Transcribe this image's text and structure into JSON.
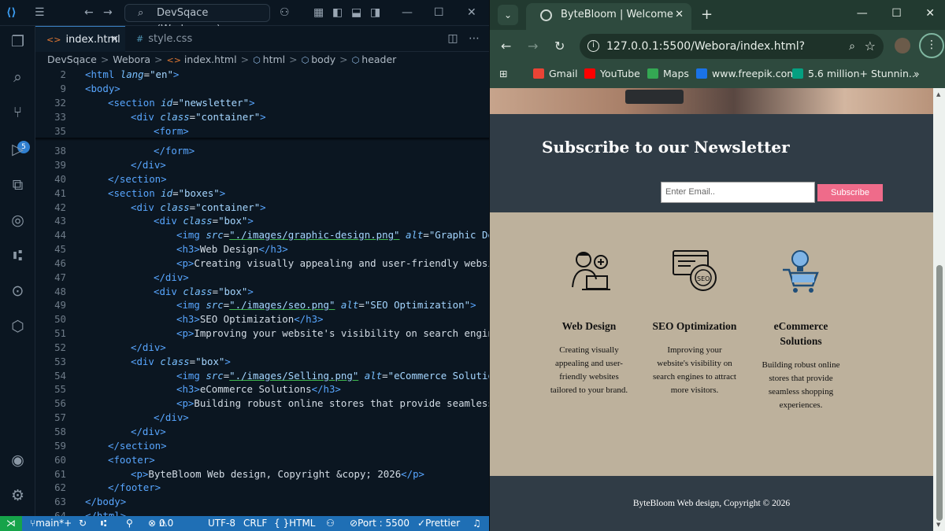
{
  "vscode": {
    "search": "DevSqace (Workspace)",
    "scm_badge": "5",
    "tabs": [
      {
        "label": "index.html"
      },
      {
        "label": "style.css"
      }
    ],
    "breadcrumb": [
      "DevSqace",
      "Webora",
      "index.html",
      "html",
      "body",
      "header"
    ],
    "lines": [
      {
        "n": "2",
        "t": [
          [
            "tg",
            "<html "
          ],
          [
            "at",
            "lang"
          ],
          [
            "tx",
            "="
          ],
          [
            "st",
            "\"en\""
          ],
          [
            "tg",
            ">"
          ]
        ],
        "ind": 0
      },
      {
        "n": "9",
        "t": [
          [
            "tg",
            "<body>"
          ]
        ],
        "ind": 0
      },
      {
        "n": "32",
        "t": [
          [
            "tg",
            "<section "
          ],
          [
            "at",
            "id"
          ],
          [
            "tx",
            "="
          ],
          [
            "st",
            "\"newsletter\""
          ],
          [
            "tg",
            ">"
          ]
        ],
        "ind": 1
      },
      {
        "n": "33",
        "t": [
          [
            "tg",
            "<div "
          ],
          [
            "at",
            "class"
          ],
          [
            "tx",
            "="
          ],
          [
            "st",
            "\"container\""
          ],
          [
            "tg",
            ">"
          ]
        ],
        "ind": 2
      },
      {
        "n": "35",
        "t": [
          [
            "tg",
            "<form>"
          ]
        ],
        "ind": 3
      },
      {
        "n": "38",
        "t": [
          [
            "tg",
            "</form>"
          ]
        ],
        "ind": 3
      },
      {
        "n": "39",
        "t": [
          [
            "tg",
            "</div>"
          ]
        ],
        "ind": 2
      },
      {
        "n": "40",
        "t": [
          [
            "tg",
            "</section>"
          ]
        ],
        "ind": 1
      },
      {
        "n": "41",
        "t": [
          [
            "tg",
            "<section "
          ],
          [
            "at",
            "id"
          ],
          [
            "tx",
            "="
          ],
          [
            "st",
            "\"boxes\""
          ],
          [
            "tg",
            ">"
          ]
        ],
        "ind": 1
      },
      {
        "n": "42",
        "t": [
          [
            "tg",
            "<div "
          ],
          [
            "at",
            "class"
          ],
          [
            "tx",
            "="
          ],
          [
            "st",
            "\"container\""
          ],
          [
            "tg",
            ">"
          ]
        ],
        "ind": 2
      },
      {
        "n": "43",
        "t": [
          [
            "tg",
            "<div "
          ],
          [
            "at",
            "class"
          ],
          [
            "tx",
            "="
          ],
          [
            "st",
            "\"box\""
          ],
          [
            "tg",
            ">"
          ]
        ],
        "ind": 3
      },
      {
        "n": "44",
        "t": [
          [
            "tg",
            "<img "
          ],
          [
            "at",
            "src"
          ],
          [
            "tx",
            "="
          ],
          [
            "st",
            "\"./images/graphic-design.png\""
          ],
          [
            "tx",
            " "
          ],
          [
            "at",
            "alt"
          ],
          [
            "tx",
            "="
          ],
          [
            "st",
            "\"Graphic Des"
          ]
        ],
        "ind": 4
      },
      {
        "n": "45",
        "t": [
          [
            "tg",
            "<h3>"
          ],
          [
            "tx",
            "Web Design"
          ],
          [
            "tg",
            "</h3>"
          ]
        ],
        "ind": 4
      },
      {
        "n": "46",
        "t": [
          [
            "tg",
            "<p>"
          ],
          [
            "tx",
            "Creating visually appealing and user-friendly websit"
          ]
        ],
        "ind": 4
      },
      {
        "n": "47",
        "t": [
          [
            "tg",
            "</div>"
          ]
        ],
        "ind": 3
      },
      {
        "n": "48",
        "t": [
          [
            "tg",
            "<div "
          ],
          [
            "at",
            "class"
          ],
          [
            "tx",
            "="
          ],
          [
            "st",
            "\"box\""
          ],
          [
            "tg",
            ">"
          ]
        ],
        "ind": 3
      },
      {
        "n": "49",
        "t": [
          [
            "tg",
            "<img "
          ],
          [
            "at",
            "src"
          ],
          [
            "tx",
            "="
          ],
          [
            "st",
            "\"./images/seo.png\""
          ],
          [
            "tx",
            " "
          ],
          [
            "at",
            "alt"
          ],
          [
            "tx",
            "="
          ],
          [
            "st",
            "\"SEO Optimization\""
          ],
          [
            "tg",
            ">"
          ]
        ],
        "ind": 4
      },
      {
        "n": "50",
        "t": [
          [
            "tg",
            "<h3>"
          ],
          [
            "tx",
            "SEO Optimization"
          ],
          [
            "tg",
            "</h3>"
          ]
        ],
        "ind": 4
      },
      {
        "n": "51",
        "t": [
          [
            "tg",
            "<p>"
          ],
          [
            "tx",
            "Improving your website's visibility on search engine"
          ]
        ],
        "ind": 4
      },
      {
        "n": "52",
        "t": [
          [
            "tg",
            "</div>"
          ]
        ],
        "ind": 2
      },
      {
        "n": "53",
        "t": [
          [
            "tg",
            "<div "
          ],
          [
            "at",
            "class"
          ],
          [
            "tx",
            "="
          ],
          [
            "st",
            "\"box\""
          ],
          [
            "tg",
            ">"
          ]
        ],
        "ind": 2
      },
      {
        "n": "54",
        "t": [
          [
            "tg",
            "<img "
          ],
          [
            "at",
            "src"
          ],
          [
            "tx",
            "="
          ],
          [
            "st",
            "\"./images/Selling.png\""
          ],
          [
            "tx",
            " "
          ],
          [
            "at",
            "alt"
          ],
          [
            "tx",
            "="
          ],
          [
            "st",
            "\"eCommerce Solution"
          ]
        ],
        "ind": 4
      },
      {
        "n": "55",
        "t": [
          [
            "tg",
            "<h3>"
          ],
          [
            "tx",
            "eCommerce Solutions"
          ],
          [
            "tg",
            "</h3>"
          ]
        ],
        "ind": 4
      },
      {
        "n": "56",
        "t": [
          [
            "tg",
            "<p>"
          ],
          [
            "tx",
            "Building robust online stores that provide seamless"
          ]
        ],
        "ind": 4
      },
      {
        "n": "57",
        "t": [
          [
            "tg",
            "</div>"
          ]
        ],
        "ind": 3
      },
      {
        "n": "58",
        "t": [
          [
            "tg",
            "</div>"
          ]
        ],
        "ind": 2
      },
      {
        "n": "59",
        "t": [
          [
            "tg",
            "</section>"
          ]
        ],
        "ind": 1
      },
      {
        "n": "60",
        "t": [
          [
            "tg",
            "<footer>"
          ]
        ],
        "ind": 1
      },
      {
        "n": "61",
        "t": [
          [
            "tg",
            "<p>"
          ],
          [
            "tx",
            "ByteBloom Web design, Copyright &copy; 2026"
          ],
          [
            "tg",
            "</p>"
          ]
        ],
        "ind": 2
      },
      {
        "n": "62",
        "t": [
          [
            "tg",
            "</footer>"
          ]
        ],
        "ind": 1
      },
      {
        "n": "63",
        "t": [
          [
            "tg",
            "</body>"
          ]
        ],
        "ind": 0
      },
      {
        "n": "64",
        "t": [
          [
            "tg",
            "</html>"
          ]
        ],
        "ind": 0
      }
    ],
    "status": {
      "branch": "main*+",
      "errors": "0",
      "warnings": "0",
      "encoding": "UTF-8",
      "eol": "CRLF",
      "language": "HTML",
      "port": "Port : 5500",
      "formatter": "Prettier"
    }
  },
  "browser": {
    "tab_title": "ByteBloom | Welcome",
    "url": "127.0.0.1:5500/Webora/index.html?",
    "bookmarks": [
      "Gmail",
      "YouTube",
      "Maps",
      "www.freepik.com",
      "5.6 million+ Stunnin..."
    ],
    "page": {
      "newsletter_title": "Subscribe to our Newsletter",
      "email_placeholder": "Enter Email..",
      "subscribe_label": "Subscribe",
      "boxes": [
        {
          "title": "Web Design",
          "text": "Creating visually appealing and user-friendly websites tailored to your brand.",
          "icon": "web-design-icon"
        },
        {
          "title": "SEO Optimization",
          "text": "Improving your website's visibility on search engines to attract more visitors.",
          "icon": "seo-gear-icon"
        },
        {
          "title": "eCommerce Solutions",
          "text": "Building robust online stores that provide seamless shopping experiences.",
          "icon": "shopping-cart-icon"
        }
      ],
      "footer": "ByteBloom Web design, Copyright © 2026"
    }
  }
}
